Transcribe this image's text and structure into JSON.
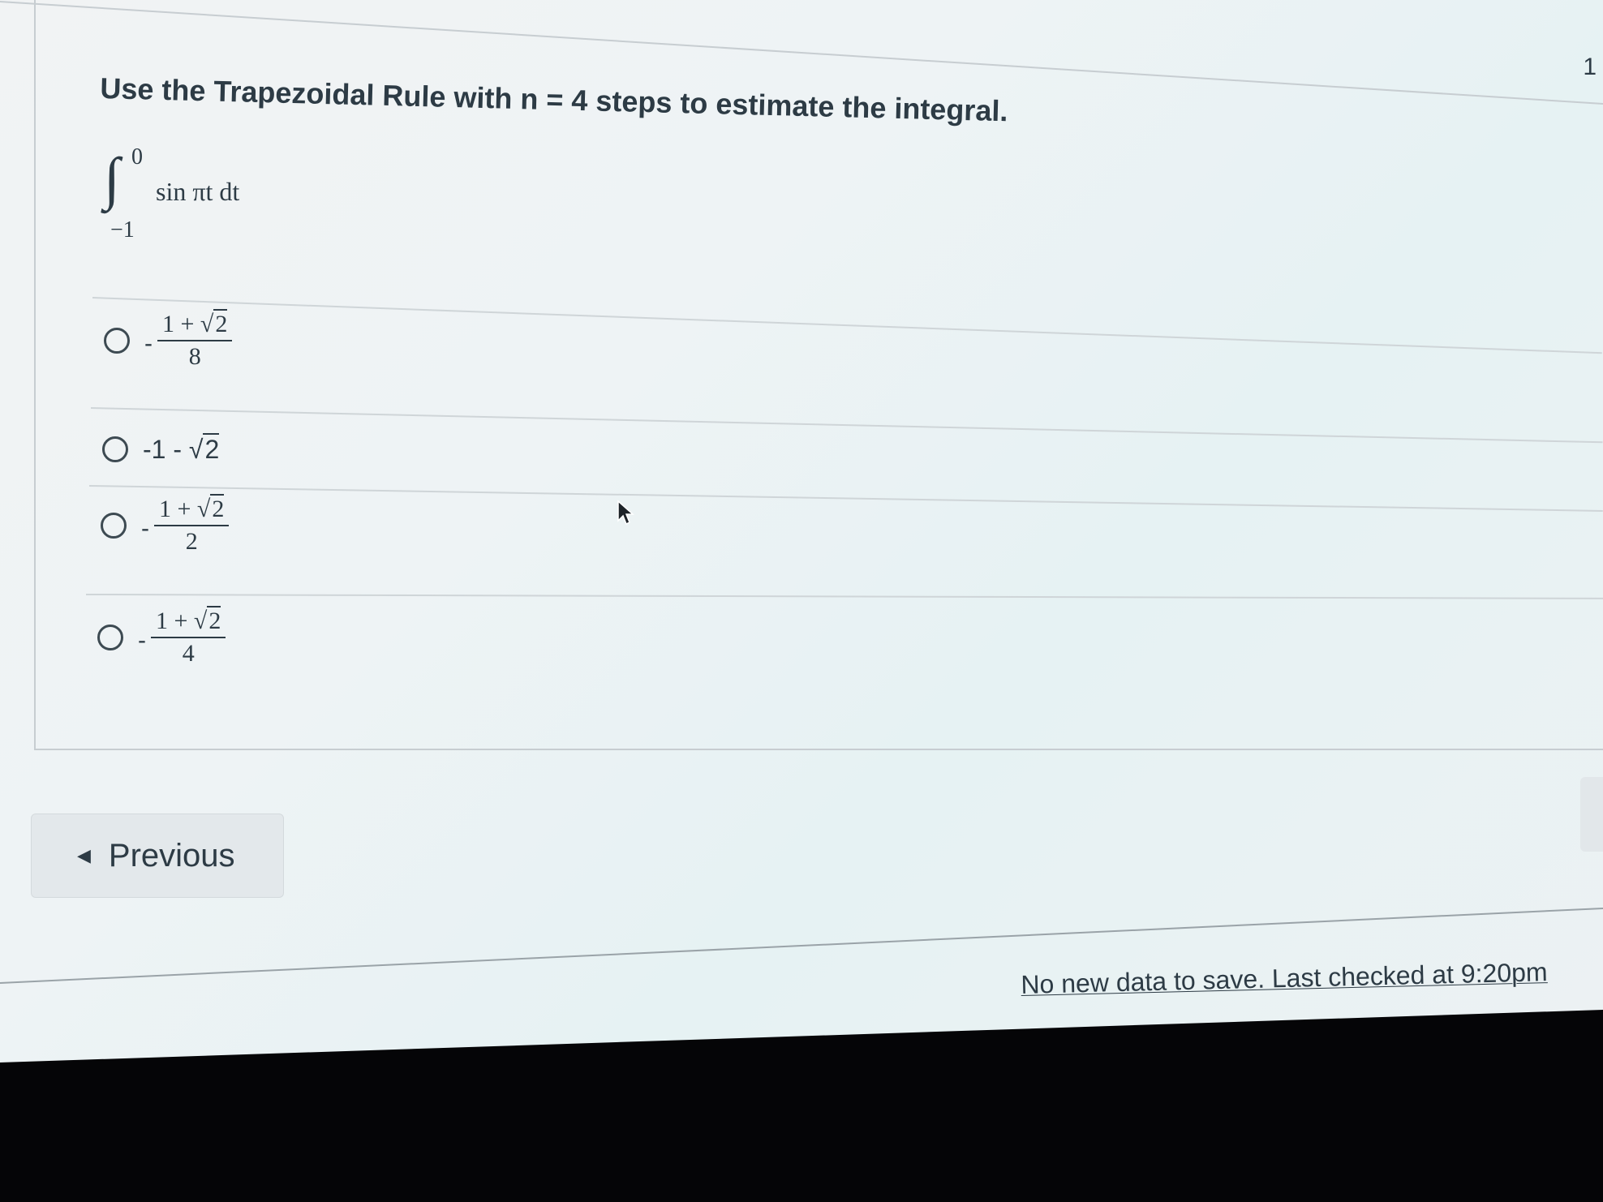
{
  "question": {
    "number": "1",
    "prompt": "Use the Trapezoidal Rule with n = 4 steps to estimate the integral.",
    "integral": {
      "sign": "∫",
      "upper_limit": "0",
      "lower_limit": "−1",
      "integrand": "sin πt dt"
    }
  },
  "answers": [
    {
      "sign": "-",
      "numerator_lead": "1 + ",
      "radicand": "2",
      "denominator": "8"
    },
    {
      "text_lead": "-1 - ",
      "radicand": "2"
    },
    {
      "sign": "-",
      "numerator_lead": "1 + ",
      "radicand": "2",
      "denominator": "2"
    },
    {
      "sign": "-",
      "numerator_lead": "1 + ",
      "radicand": "2",
      "denominator": "4"
    }
  ],
  "navigation": {
    "previous_label": "Previous",
    "previous_icon": "caret-left-icon"
  },
  "status": {
    "text": "No new data to save. Last checked at 9:20pm"
  },
  "colors": {
    "text": "#2d3b45",
    "button_bg": "#e3e8eb",
    "divider": "#cfd5d8",
    "bezel": "#050507"
  }
}
